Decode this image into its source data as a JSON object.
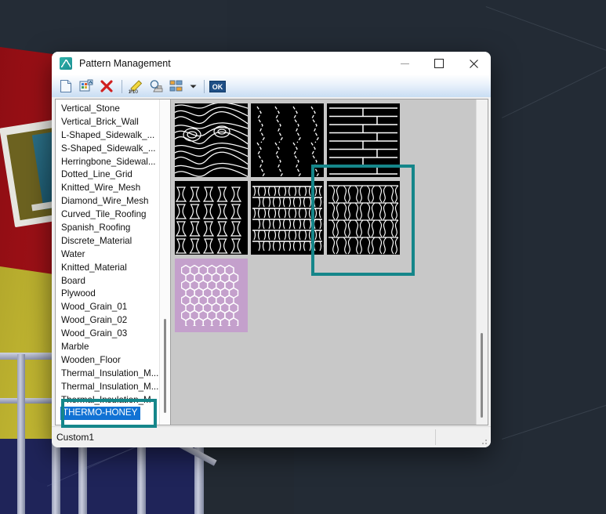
{
  "window": {
    "title": "Pattern Management",
    "icon": "app-pattern-icon",
    "controls": {
      "minimize": "–",
      "maximize": "□",
      "close": "✕"
    }
  },
  "toolbar": {
    "items": [
      {
        "name": "new-pattern-button",
        "icon": "new-document-icon",
        "label": "New"
      },
      {
        "name": "import-pattern-button",
        "icon": "import-palette-icon",
        "label": "Import"
      },
      {
        "name": "delete-pattern-button",
        "icon": "delete-x-icon",
        "label": "Delete"
      },
      {
        "name": "edit-scale-button",
        "icon": "pencil-scale-icon",
        "label": "1:10"
      },
      {
        "name": "preview-button",
        "icon": "magnifier-stamp-icon",
        "label": "Preview"
      },
      {
        "name": "view-mode-button",
        "icon": "grid-view-icon",
        "label": "View"
      },
      {
        "name": "view-mode-dropdown",
        "icon": "chevron-down-icon",
        "label": "▾"
      },
      {
        "name": "ok-button",
        "icon": "ok-badge-icon",
        "label": "OK"
      }
    ]
  },
  "pattern_list": {
    "items": [
      "Vertical_Stone",
      "Vertical_Brick_Wall",
      "L-Shaped_Sidewalk_...",
      "S-Shaped_Sidewalk_...",
      "Herringbone_Sidewal...",
      "Dotted_Line_Grid",
      "Knitted_Wire_Mesh",
      "Diamond_Wire_Mesh",
      "Curved_Tile_Roofing",
      "Spanish_Roofing",
      "Discrete_Material",
      "Water",
      "Knitted_Material",
      "Board",
      "Plywood",
      "Wood_Grain_01",
      "Wood_Grain_02",
      "Wood_Grain_03",
      "Marble",
      "Wooden_Floor",
      "Thermal_Insulation_M...",
      "Thermal_Insulation_M...",
      "Thermal_Insulation_M"
    ],
    "selected": "THERMO-HONEY"
  },
  "gallery": {
    "thumbnails": [
      {
        "name": "thumbnail-wood-grain",
        "pattern": "wood-grain",
        "selected": false
      },
      {
        "name": "thumbnail-marble-crack",
        "pattern": "marble",
        "selected": false
      },
      {
        "name": "thumbnail-wooden-floor",
        "pattern": "floor-planks",
        "selected": false
      },
      {
        "name": "thumbnail-thermal-insulation",
        "pattern": "insulation",
        "selected": false
      },
      {
        "name": "thumbnail-brick-knit",
        "pattern": "knit-brick",
        "selected": false
      },
      {
        "name": "thumbnail-knitted-material",
        "pattern": "knit-loop",
        "selected": false
      },
      {
        "name": "thumbnail-thermo-honey",
        "pattern": "honeycomb",
        "selected": true
      }
    ],
    "selected_swatch_color": "#c4a0cc",
    "selected_line_color": "#ffffff"
  },
  "status": {
    "text": "Custom1"
  },
  "annotations": {
    "highlight_color": "#15868a",
    "boxes": [
      {
        "name": "highlight-selected-thumbnail",
        "target": "thumbnail-thermo-honey"
      },
      {
        "name": "highlight-selected-list-item",
        "target": "THERMO-HONEY"
      }
    ]
  }
}
